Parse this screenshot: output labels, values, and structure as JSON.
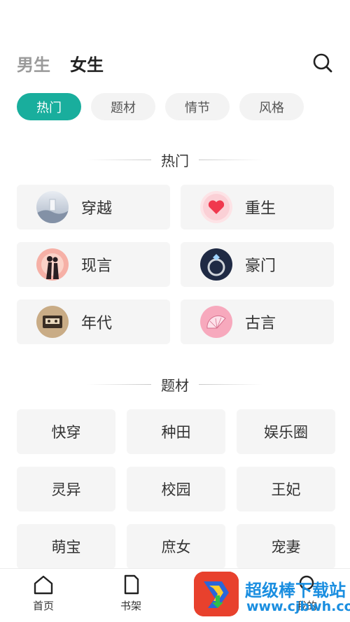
{
  "header": {
    "tabs": [
      {
        "label": "男生",
        "active": false
      },
      {
        "label": "女生",
        "active": true
      }
    ],
    "search_icon": "search-icon"
  },
  "filters": [
    {
      "label": "热门",
      "active": true
    },
    {
      "label": "题材",
      "active": false
    },
    {
      "label": "情节",
      "active": false
    },
    {
      "label": "风格",
      "active": false
    }
  ],
  "hot_section": {
    "title": "热门",
    "items": [
      {
        "label": "穿越",
        "icon": "time-travel-avatar"
      },
      {
        "label": "重生",
        "icon": "heart-avatar"
      },
      {
        "label": "现言",
        "icon": "couple-avatar"
      },
      {
        "label": "豪门",
        "icon": "ring-avatar"
      },
      {
        "label": "年代",
        "icon": "cassette-avatar"
      },
      {
        "label": "古言",
        "icon": "fan-avatar"
      }
    ]
  },
  "topic_section": {
    "title": "题材",
    "items": [
      "快穿",
      "种田",
      "娱乐圈",
      "灵异",
      "校园",
      "王妃",
      "萌宝",
      "庶女",
      "宠妻"
    ]
  },
  "bottom_nav": [
    {
      "label": "首页",
      "icon": "home-icon"
    },
    {
      "label": "书架",
      "icon": "bookshelf-icon"
    },
    {
      "label": "我的",
      "icon": "profile-icon"
    }
  ],
  "watermark": {
    "text": "超级棒下载站",
    "url": "www.cjbwh.com"
  },
  "colors": {
    "accent": "#19ae9d",
    "card_bg": "#f5f5f5"
  }
}
